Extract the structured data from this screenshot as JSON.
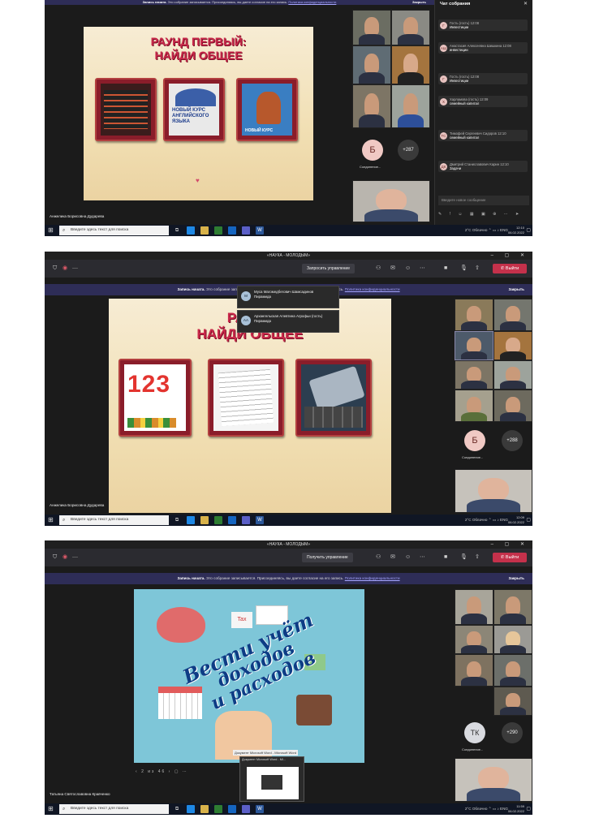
{
  "shot1": {
    "banner": {
      "bold": "Запись начата.",
      "text": "Это собрание записывается. Присоединяясь, вы даете согласие на его запись.",
      "link": "Политика конфиденциальности",
      "close": "Закрыть"
    },
    "slide": {
      "title_line1": "РАУНД ПЕРВЫЙ:",
      "title_line2": "НАЙДИ ОБЩЕЕ",
      "card2_text": "НОВЫЙ КУРС АНГЛИЙСКОГО ЯЗЫКА",
      "card3_text": "НОВЫЙ КУРС"
    },
    "participants": {
      "avatar_letter": "Б",
      "avatar_caption": "Соединение...",
      "more_count": "+287"
    },
    "presenter": "Анжелика Борисовна Дударева",
    "chat": {
      "title": "Чат собрания",
      "messages": [
        {
          "avatar": "Г",
          "name": "Гость (гость)",
          "time": "12:08",
          "text": "Инвестиции"
        },
        {
          "avatar": "АШ",
          "name": "Анастасия Алексеевна Шишкина",
          "time": "12:08",
          "text": "инвестиции"
        },
        {
          "avatar": "Г",
          "name": "Гость (гость)",
          "time": "12:08",
          "text": "Инвестиции"
        },
        {
          "avatar": "Х",
          "name": "Харламова (гость)",
          "time": "12:09",
          "text": "семейный капитал"
        },
        {
          "avatar": "ТС",
          "name": "Тимофей Сергеевич Сидоров",
          "time": "12:10",
          "text": "семейный капитал"
        },
        {
          "avatar": "ДК",
          "name": "Дмитрий Станиславович Карин",
          "time": "12:10",
          "text": "Задачи"
        }
      ],
      "input_placeholder": "Введите новое сообщение"
    },
    "taskbar": {
      "search": "Введите здесь текст для поиска",
      "weather": "2°C Облачно",
      "lang": "ENG",
      "time": "12:10",
      "date": "06.02.2022"
    }
  },
  "shot2": {
    "window_title": "«НАУКА - МОЛОДЫМ»",
    "request_control": "Запросить управление",
    "exit": "Выйти",
    "banner": {
      "bold": "Запись начата.",
      "text": "Это собрание записывается. Присоединяясь, вы даете согласие на его запись.",
      "link": "Политика конфиденциальности",
      "close": "Закрыть"
    },
    "popup": [
      {
        "avatar": "М",
        "name": "Муса Магомедбегович Шамсадинов",
        "text": "Пирамида"
      },
      {
        "avatar": "АА",
        "name": "Архангельская Алевтина Агрофьи (гость)",
        "text": "Пирамида"
      }
    ],
    "slide": {
      "title_line1": "РАУНД",
      "title_line2": "НАЙДИ ОБЩЕЕ",
      "card1_text": "123"
    },
    "participants": {
      "avatar_letter": "Б",
      "avatar_caption": "Соединение...",
      "more_count": "+288"
    },
    "presenter": "Анжелика Борисовна Дударева",
    "taskbar": {
      "search": "Введите здесь текст для поиска",
      "weather": "2°C Облачно",
      "lang": "ENG",
      "time": "12:09",
      "date": "06.02.2022"
    }
  },
  "shot3": {
    "window_title": "«НАУКА - МОЛОДЫМ»",
    "request_control": "Получить управление",
    "exit": "Выйти",
    "banner": {
      "bold": "Запись начата.",
      "text": "Это собрание записывается. Присоединяясь, вы даете согласие на его запись.",
      "link": "Политика конфиденциальности",
      "close": "Закрыть"
    },
    "slide": {
      "line1": "Вести учёт",
      "line2": "доходов",
      "line3": "и расходов",
      "tax": "Tax",
      "word_tooltip": "Документ Microsoft Word - Microsoft Word"
    },
    "pager": "2 из 46",
    "preview_caption": "Документ Microsoft Word - Mi...",
    "participants": {
      "avatar_letter": "ТК",
      "avatar_caption": "Соединение...",
      "more_count": "+290"
    },
    "presenter": "Татьяна Святославовна Кравченко",
    "taskbar": {
      "search": "Введите здесь текст для поиска",
      "weather": "2°C Облачно",
      "lang": "ENG",
      "time": "11:59",
      "date": "06.02.2022"
    }
  },
  "colors": {
    "banner": "#2e2d57",
    "exit": "#c4314b",
    "slide_title": "#c8284a",
    "frame": "#8a1d2a"
  }
}
